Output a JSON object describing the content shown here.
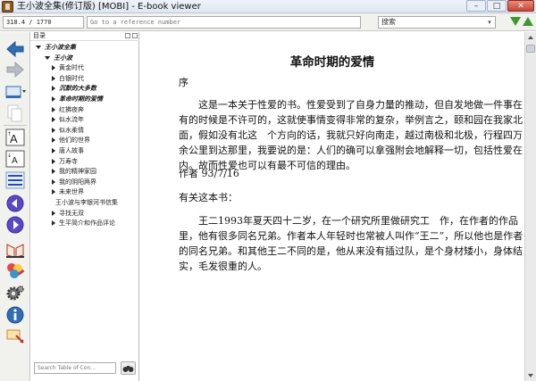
{
  "window": {
    "title": "王小波全集(修订版) [MOBI] - E-book viewer",
    "minimize": "–",
    "maximize": "□",
    "close": "✕"
  },
  "toolbar": {
    "position": "318.4 / 1770",
    "goto_placeholder": "Go to a reference number",
    "search_value": "搜索",
    "search_dropdown": "▾",
    "icons": [
      "next-match-down-icon",
      "previous-match-up-icon"
    ],
    "accent": "#3a9a2a"
  },
  "sidebar_icons": [
    "back-arrow-icon",
    "forward-arrow-icon",
    "open-book-icon",
    "copy-icon",
    "font-larger-icon",
    "font-smaller-icon",
    "table-of-contents-icon",
    "previous-page-icon",
    "next-page-icon",
    "reference-mode-icon",
    "theme-icon",
    "preferences-gear-icon",
    "info-icon",
    "full-screen-icon"
  ],
  "toc": {
    "header": "目录",
    "items": [
      {
        "label": "王小波全集",
        "level": 0,
        "toggle": "open",
        "emph": true
      },
      {
        "label": "王小波",
        "level": 1,
        "toggle": "open",
        "emph": true
      },
      {
        "label": "黄金时代",
        "level": 2,
        "toggle": "closed",
        "emph": false
      },
      {
        "label": "白银时代",
        "level": 2,
        "toggle": "closed",
        "emph": false
      },
      {
        "label": "沉默的大多数",
        "level": 2,
        "toggle": "closed",
        "emph": true
      },
      {
        "label": "革命时期的爱情",
        "level": 2,
        "toggle": "closed",
        "emph": true
      },
      {
        "label": "红拂夜奔",
        "level": 2,
        "toggle": "closed",
        "emph": false
      },
      {
        "label": "似水流年",
        "level": 2,
        "toggle": "closed",
        "emph": false
      },
      {
        "label": "似水柔情",
        "level": 2,
        "toggle": "closed",
        "emph": false
      },
      {
        "label": "他们的世界",
        "level": 2,
        "toggle": "closed",
        "emph": false
      },
      {
        "label": "唐人故事",
        "level": 2,
        "toggle": "closed",
        "emph": false
      },
      {
        "label": "万寿寺",
        "level": 2,
        "toggle": "closed",
        "emph": false
      },
      {
        "label": "我的精神家园",
        "level": 2,
        "toggle": "closed",
        "emph": false
      },
      {
        "label": "我的阴阳两界",
        "level": 2,
        "toggle": "closed",
        "emph": false
      },
      {
        "label": "未来世界",
        "level": 2,
        "toggle": "closed",
        "emph": false
      },
      {
        "label": "王小波与李银河书信集",
        "level": 2,
        "toggle": "none",
        "emph": false
      },
      {
        "label": "寻找无双",
        "level": 2,
        "toggle": "closed",
        "emph": false
      },
      {
        "label": "生平简介和作品评论",
        "level": 2,
        "toggle": "closed",
        "emph": false
      }
    ],
    "search_placeholder": "Search Table of Con..."
  },
  "reader": {
    "chapter_title": "革命时期的爱情",
    "paragraphs": [
      "序",
      "这是一本关于性爱的书。性爱受到了自身力量的推动，但自发地做一件事在有的时候是不许可的，这就使事情变得非常的复杂，举例言之，颐和园在我家北面，假如没有北这　个方向的话，我就只好向南走，越过南极和北极，行程四万余公里到达那里，我要说的是：人们的确可以拿强附会地解释一切，包括性爱在内。故而性爱也可以有最不可信的理由。",
      "作者 93/7/16",
      "有关这本书：",
      "王二1993年夏天四十二岁，在一个研究所里做研究工　作，在作者的作品里，他有很多同名兄弟。作者本人年轻时也常被人叫作“王二”，所以他也是作者的同名兄弟。和其他王二不同的是，他从来没有插过队，是个身材矮小，身体结实，毛发很重的人。"
    ]
  }
}
